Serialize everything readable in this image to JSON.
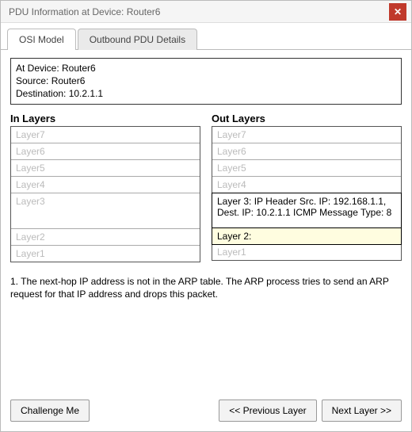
{
  "window": {
    "title": "PDU Information at Device: Router6"
  },
  "tabs": [
    {
      "label": "OSI Model",
      "active": true
    },
    {
      "label": "Outbound PDU Details",
      "active": false
    }
  ],
  "info": {
    "at_device_label": "At Device: Router6",
    "source_label": "Source: Router6",
    "destination_label": "Destination: 10.2.1.1"
  },
  "columns": {
    "in": {
      "title": "In Layers",
      "layers": {
        "l7": "Layer7",
        "l6": "Layer6",
        "l5": "Layer5",
        "l4": "Layer4",
        "l3": "Layer3",
        "l2": "Layer2",
        "l1": "Layer1"
      }
    },
    "out": {
      "title": "Out Layers",
      "layers": {
        "l7": "Layer7",
        "l6": "Layer6",
        "l5": "Layer5",
        "l4": "Layer4",
        "l3": "Layer 3: IP Header Src. IP: 192.168.1.1, Dest. IP: 10.2.1.1 ICMP Message Type: 8",
        "l2": "Layer 2:",
        "l1": "Layer1"
      }
    }
  },
  "note": "1. The next-hop IP address is not in the ARP table. The ARP process tries to send an ARP request for that IP address and drops this packet.",
  "buttons": {
    "challenge": "Challenge Me",
    "prev": "<< Previous Layer",
    "next": "Next Layer >>"
  }
}
